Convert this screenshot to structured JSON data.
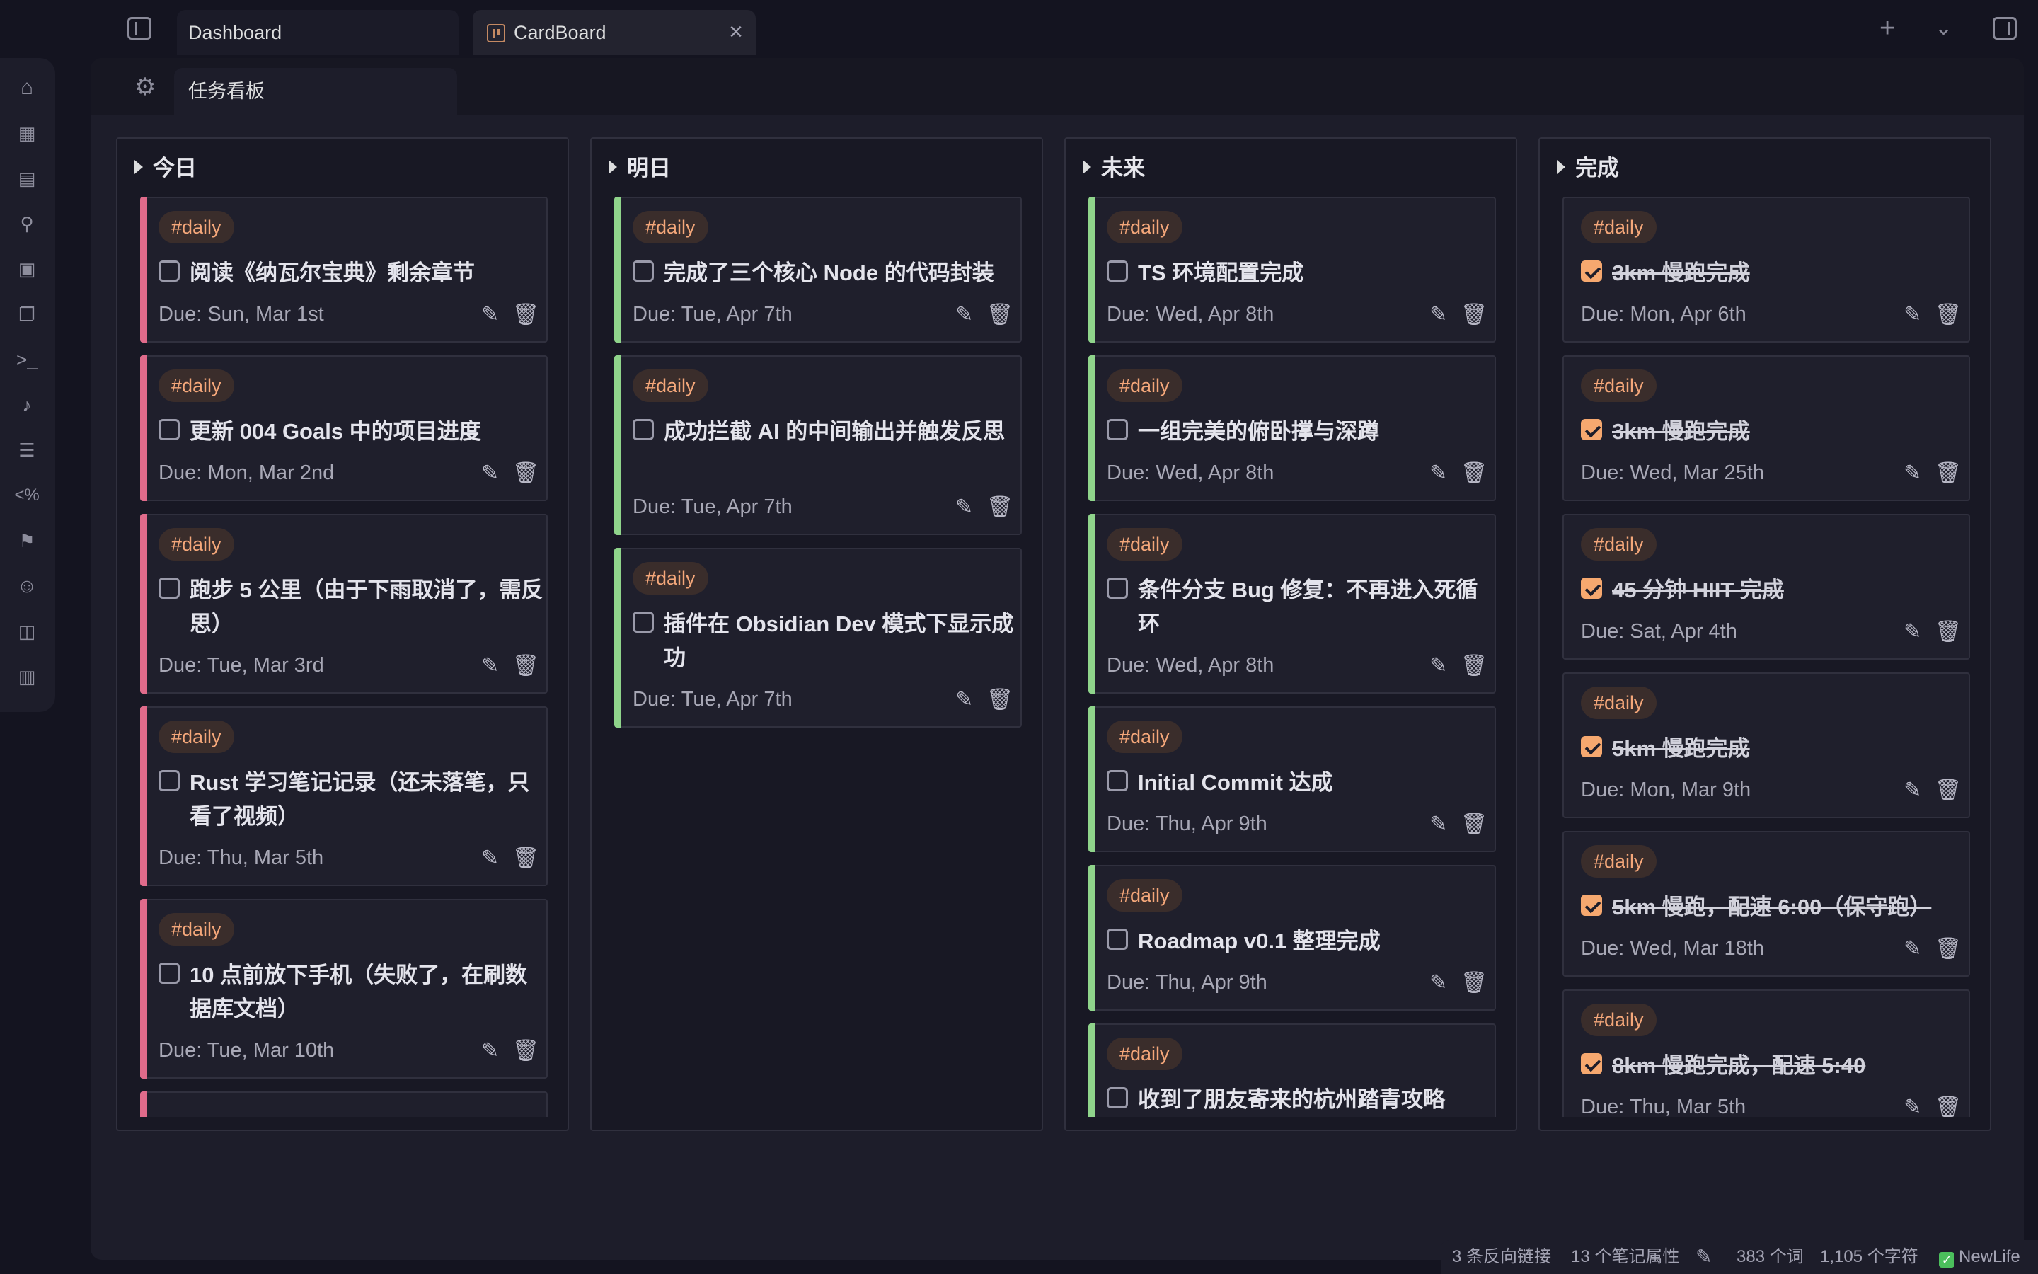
{
  "tabs": {
    "dashboard": "Dashboard",
    "cardboard": "CardBoard"
  },
  "subtab": {
    "label": "任务看板"
  },
  "icons": {
    "new_tab": "plus-icon",
    "tab_list": "chevron-down-icon",
    "close": "close-icon",
    "settings": "gear-icon"
  },
  "ribbon": [
    "home-icon",
    "calendar-icon",
    "file-search-icon",
    "graph-icon",
    "grid-icon",
    "files-icon",
    "terminal-icon",
    "microphone-icon",
    "list-icon",
    "template-percent-icon",
    "flag-icon",
    "smiley-icon",
    "layout-icon",
    "kanban-icon"
  ],
  "columns": [
    {
      "title": "今日",
      "cards": [
        {
          "tag": "#daily",
          "title": "阅读《纳瓦尔宝典》剩余章节",
          "due": "Due: Sun, Mar 1st",
          "checked": false
        },
        {
          "tag": "#daily",
          "title": "更新 004 Goals 中的项目进度",
          "due": "Due: Mon, Mar 2nd",
          "checked": false
        },
        {
          "tag": "#daily",
          "title": "跑步 5 公里（由于下雨取消了，需反思）",
          "due": "Due: Tue, Mar 3rd",
          "checked": false
        },
        {
          "tag": "#daily",
          "title": "Rust 学习笔记记录（还未落笔，只看了视频）",
          "due": "Due: Thu, Mar 5th",
          "checked": false
        },
        {
          "tag": "#daily",
          "title": "10 点前放下手机（失败了，在刷数据库文档）",
          "due": "Due: Tue, Mar 10th",
          "checked": false
        }
      ]
    },
    {
      "title": "明日",
      "cards": [
        {
          "tag": "#daily",
          "title": "完成了三个核心 Node 的代码封装",
          "due": "Due: Tue, Apr 7th",
          "checked": false
        },
        {
          "tag": "#daily",
          "title": "成功拦截 AI 的中间输出并触发反思",
          "due": "Due: Tue, Apr 7th",
          "checked": false
        },
        {
          "tag": "#daily",
          "title": "插件在 Obsidian Dev 模式下显示成功",
          "due": "Due: Tue, Apr 7th",
          "checked": false
        }
      ]
    },
    {
      "title": "未来",
      "cards": [
        {
          "tag": "#daily",
          "title": "TS 环境配置完成",
          "due": "Due: Wed, Apr 8th",
          "checked": false
        },
        {
          "tag": "#daily",
          "title": "一组完美的俯卧撑与深蹲",
          "due": "Due: Wed, Apr 8th",
          "checked": false
        },
        {
          "tag": "#daily",
          "title": "条件分支 Bug 修复：不再进入死循环",
          "due": "Due: Wed, Apr 8th",
          "checked": false
        },
        {
          "tag": "#daily",
          "title": "Initial Commit 达成",
          "due": "Due: Thu, Apr 9th",
          "checked": false
        },
        {
          "tag": "#daily",
          "title": "Roadmap v0.1 整理完成",
          "due": "Due: Thu, Apr 9th",
          "checked": false
        },
        {
          "tag": "#daily",
          "title": "收到了朋友寄来的杭州踏青攻略",
          "due": "",
          "checked": false
        }
      ]
    },
    {
      "title": "完成",
      "cards": [
        {
          "tag": "#daily",
          "title": "3km 慢跑完成",
          "due": "Due: Mon, Apr 6th",
          "checked": true
        },
        {
          "tag": "#daily",
          "title": "3km 慢跑完成",
          "due": "Due: Wed, Mar 25th",
          "checked": true
        },
        {
          "tag": "#daily",
          "title": "45 分钟 HIIT 完成",
          "due": "Due: Sat, Apr 4th",
          "checked": true
        },
        {
          "tag": "#daily",
          "title": "5km 慢跑完成",
          "due": "Due: Mon, Mar 9th",
          "checked": true
        },
        {
          "tag": "#daily",
          "title": "5km 慢跑，配速 6:00（保守跑）",
          "due": "Due: Wed, Mar 18th",
          "checked": true
        },
        {
          "tag": "#daily",
          "title": "8km 慢跑完成，配速 5:40",
          "due": "Due: Thu, Mar 5th",
          "checked": true
        }
      ]
    }
  ],
  "statusbar": {
    "backlinks": "3 条反向链接",
    "properties": "13 个笔记属性",
    "words": "383 个词",
    "chars": "1,105 个字符",
    "newlife": "NewLife"
  }
}
